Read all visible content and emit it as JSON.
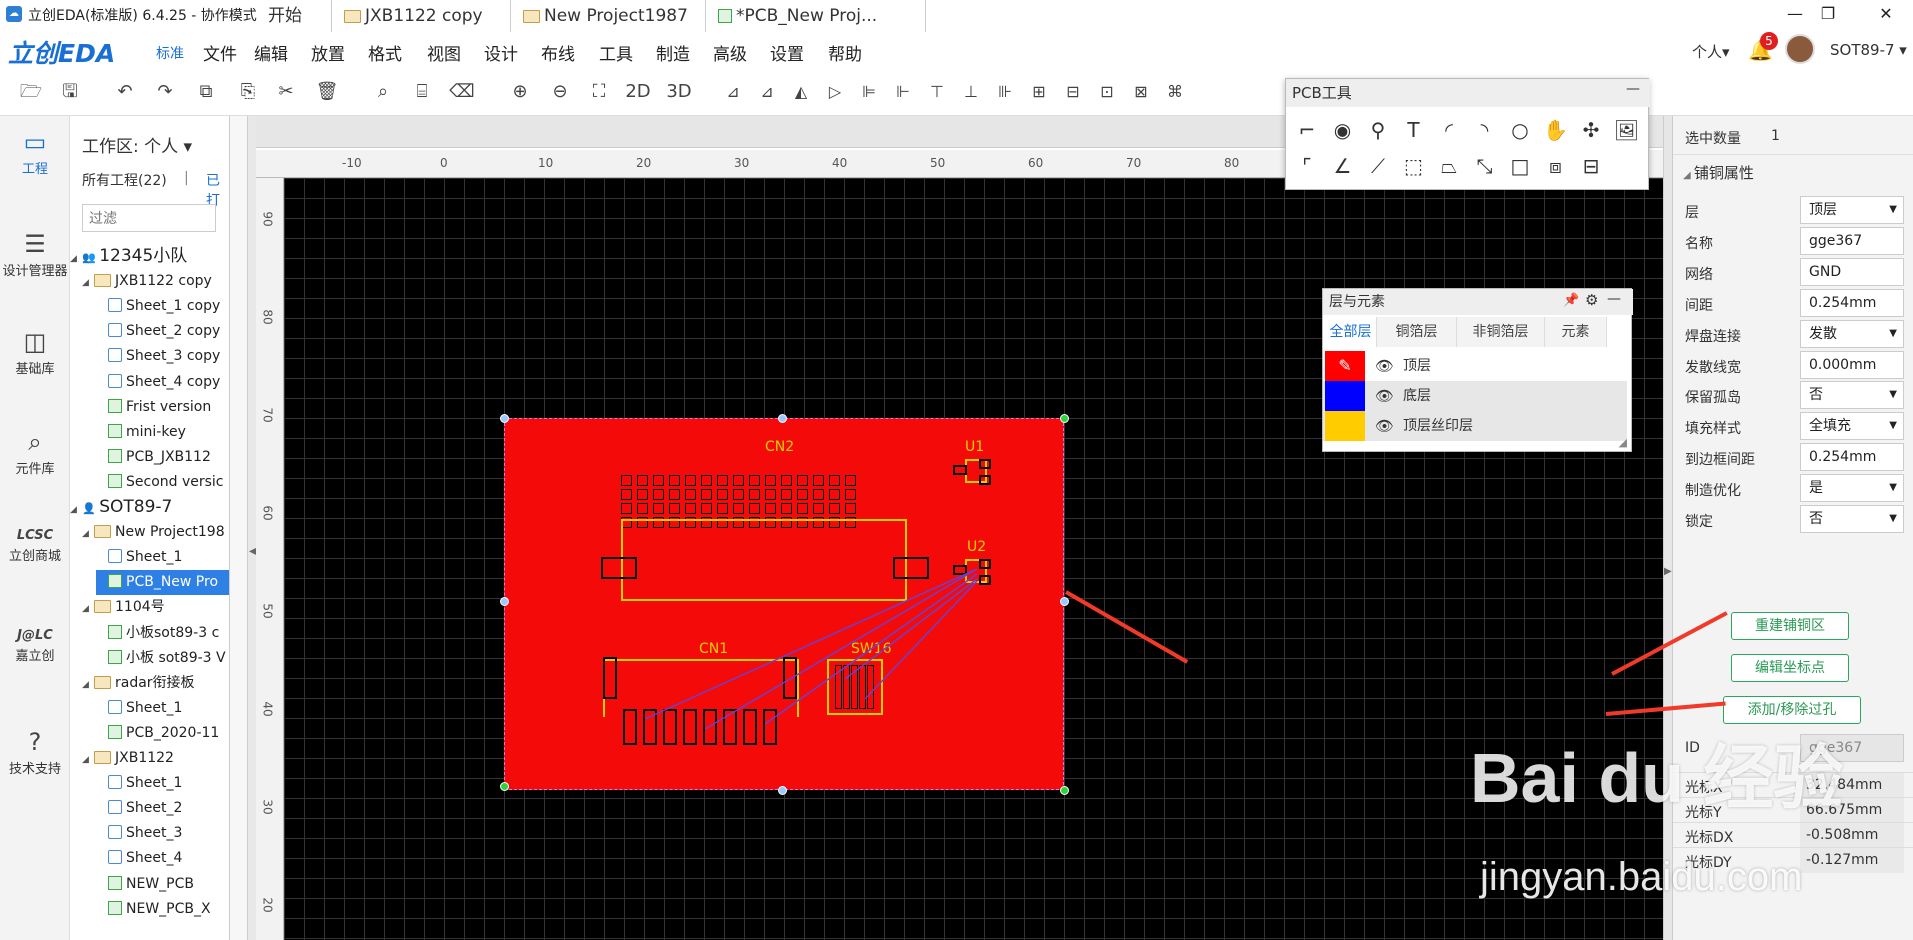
{
  "titlebar": {
    "title": "立创EDA(标准版) 6.4.25 - 协作模式",
    "min": "—",
    "max": "❐",
    "close": "✕"
  },
  "brand": {
    "name": "立创EDA",
    "sub": "标准"
  },
  "menu": [
    "文件",
    "编辑",
    "放置",
    "格式",
    "视图",
    "设计",
    "布线",
    "工具",
    "制造",
    "高级",
    "设置",
    "帮助"
  ],
  "user": {
    "workspace": "个人▾",
    "bell_count": "5",
    "project": "SOT89-7 ▾"
  },
  "toolbar_icons": [
    "folder-open-icon",
    "save-icon",
    "undo-icon",
    "redo-icon",
    "copy-icon",
    "paste-icon",
    "cut-icon",
    "delete-icon",
    "search-icon",
    "find-icon",
    "erase-icon",
    "zoom-in-icon",
    "zoom-out-icon",
    "fit-icon",
    "2d-view",
    "3d-view"
  ],
  "toolbar_text": {
    "v2d": "2D",
    "v3d": "3D"
  },
  "leftnav": [
    {
      "icon": "▭",
      "label": "工程"
    },
    {
      "icon": "☰",
      "label": "设计管理器"
    },
    {
      "icon": "◫",
      "label": "基础库"
    },
    {
      "icon": "⌕",
      "label": "元件库"
    },
    {
      "icon": "LCSC",
      "label": "立创商城"
    },
    {
      "icon": "J@LC",
      "label": "嘉立创"
    },
    {
      "icon": "?",
      "label": "技术支持"
    }
  ],
  "projects": {
    "workspace": "工作区: 个人 ▾",
    "all": "所有工程(22)",
    "sep": "|",
    "archived": "已打",
    "filter_placeholder": "过滤",
    "tree": [
      {
        "type": "team",
        "label": "12345小队",
        "indent": 0
      },
      {
        "type": "folder",
        "label": "JXB1122 copy",
        "indent": 1
      },
      {
        "type": "sch",
        "label": "Sheet_1 copy",
        "indent": 2
      },
      {
        "type": "sch",
        "label": "Sheet_2 copy",
        "indent": 2
      },
      {
        "type": "sch",
        "label": "Sheet_3 copy",
        "indent": 2
      },
      {
        "type": "sch",
        "label": "Sheet_4 copy",
        "indent": 2
      },
      {
        "type": "pcb",
        "label": "Frist version",
        "indent": 2
      },
      {
        "type": "pcb",
        "label": "mini-key",
        "indent": 2
      },
      {
        "type": "pcb",
        "label": "PCB_JXB112",
        "indent": 2
      },
      {
        "type": "pcb",
        "label": "Second versic",
        "indent": 2
      },
      {
        "type": "user",
        "label": "SOT89-7",
        "indent": 0
      },
      {
        "type": "folder",
        "label": "New Project198",
        "indent": 1
      },
      {
        "type": "sch",
        "label": "Sheet_1",
        "indent": 2
      },
      {
        "type": "pcb",
        "label": "PCB_New Pro",
        "indent": 2,
        "selected": true
      },
      {
        "type": "folder",
        "label": "1104号",
        "indent": 1
      },
      {
        "type": "pcb",
        "label": "小板sot89-3 c",
        "indent": 2
      },
      {
        "type": "pcb",
        "label": "小板 sot89-3 V",
        "indent": 2
      },
      {
        "type": "folder",
        "label": "radar衔接板",
        "indent": 1
      },
      {
        "type": "sch",
        "label": "Sheet_1",
        "indent": 2
      },
      {
        "type": "pcb",
        "label": "PCB_2020-11",
        "indent": 2
      },
      {
        "type": "folder",
        "label": "JXB1122",
        "indent": 1
      },
      {
        "type": "sch",
        "label": "Sheet_1",
        "indent": 2
      },
      {
        "type": "sch",
        "label": "Sheet_2",
        "indent": 2
      },
      {
        "type": "sch",
        "label": "Sheet_3",
        "indent": 2
      },
      {
        "type": "sch",
        "label": "Sheet_4",
        "indent": 2
      },
      {
        "type": "pcb",
        "label": "NEW_PCB",
        "indent": 2
      },
      {
        "type": "pcb",
        "label": "NEW_PCB_X",
        "indent": 2
      }
    ]
  },
  "tabs": [
    {
      "label": "开始"
    },
    {
      "label": "JXB1122 copy"
    },
    {
      "label": "New Project1987"
    },
    {
      "label": "*PCB_New Proj..."
    }
  ],
  "ruler_top": [
    "-10",
    "0",
    "10",
    "20",
    "30",
    "40",
    "50",
    "60",
    "70",
    "80"
  ],
  "ruler_left": [
    "90",
    "80",
    "70",
    "60",
    "50",
    "40",
    "30",
    "20"
  ],
  "pcb": {
    "labels": {
      "cn2": "CN2",
      "cn1": "CN1",
      "u1": "U1",
      "u2": "U2",
      "sw16": "SW16"
    }
  },
  "pcbtools": {
    "title": "PCB工具",
    "close": "—",
    "tools": [
      "track-icon",
      "via-icon",
      "pad-icon",
      "text-icon",
      "arc-icon",
      "arc2-icon",
      "circle-icon",
      "pan-hand-icon",
      "hole-icon",
      "image-icon",
      "line-icon",
      "angle-icon",
      "connect-icon",
      "rect-select-icon",
      "shape-icon",
      "measure-icon",
      "rectangle-icon",
      "group-icon",
      "footprint-icon"
    ]
  },
  "layers": {
    "title": "层与元素",
    "tabs": [
      "全部层",
      "铜箔层",
      "非铜箔层",
      "元素"
    ],
    "rows": [
      {
        "label": "顶层",
        "color": "#ff0000",
        "icon": "✎"
      },
      {
        "label": "底层",
        "color": "#0000ff",
        "icon": ""
      },
      {
        "label": "顶层丝印层",
        "color": "#ffcc00",
        "icon": ""
      }
    ]
  },
  "props": {
    "count_label": "选中数量",
    "count_value": "1",
    "section": "铺铜属性",
    "fields": [
      {
        "label": "层",
        "value": "顶层",
        "select": true
      },
      {
        "label": "名称",
        "value": "gge367",
        "select": false
      },
      {
        "label": "网络",
        "value": "GND",
        "select": false
      },
      {
        "label": "间距",
        "value": "0.254mm",
        "select": false
      },
      {
        "label": "焊盘连接",
        "value": "发散",
        "select": true
      },
      {
        "label": "发散线宽",
        "value": "0.000mm",
        "select": false
      },
      {
        "label": "保留孤岛",
        "value": "否",
        "select": true
      },
      {
        "label": "填充样式",
        "value": "全填充",
        "select": true
      },
      {
        "label": "到边框间距",
        "value": "0.254mm",
        "select": false
      },
      {
        "label": "制造优化",
        "value": "是",
        "select": true
      },
      {
        "label": "锁定",
        "value": "否",
        "select": true
      }
    ],
    "buttons": [
      "重建铺铜区",
      "编辑坐标点",
      "添加/移除过孔"
    ],
    "id_label": "ID",
    "id_value": "gge367",
    "readouts": [
      {
        "label": "光标X",
        "value": "32.484mm"
      },
      {
        "label": "光标Y",
        "value": "66.675mm"
      },
      {
        "label": "光标DX",
        "value": "-0.508mm"
      },
      {
        "label": "光标DY",
        "value": "-0.127mm"
      }
    ]
  },
  "watermark": {
    "brand": "Bai du 经验",
    "url": "jingyan.baidu.com"
  }
}
